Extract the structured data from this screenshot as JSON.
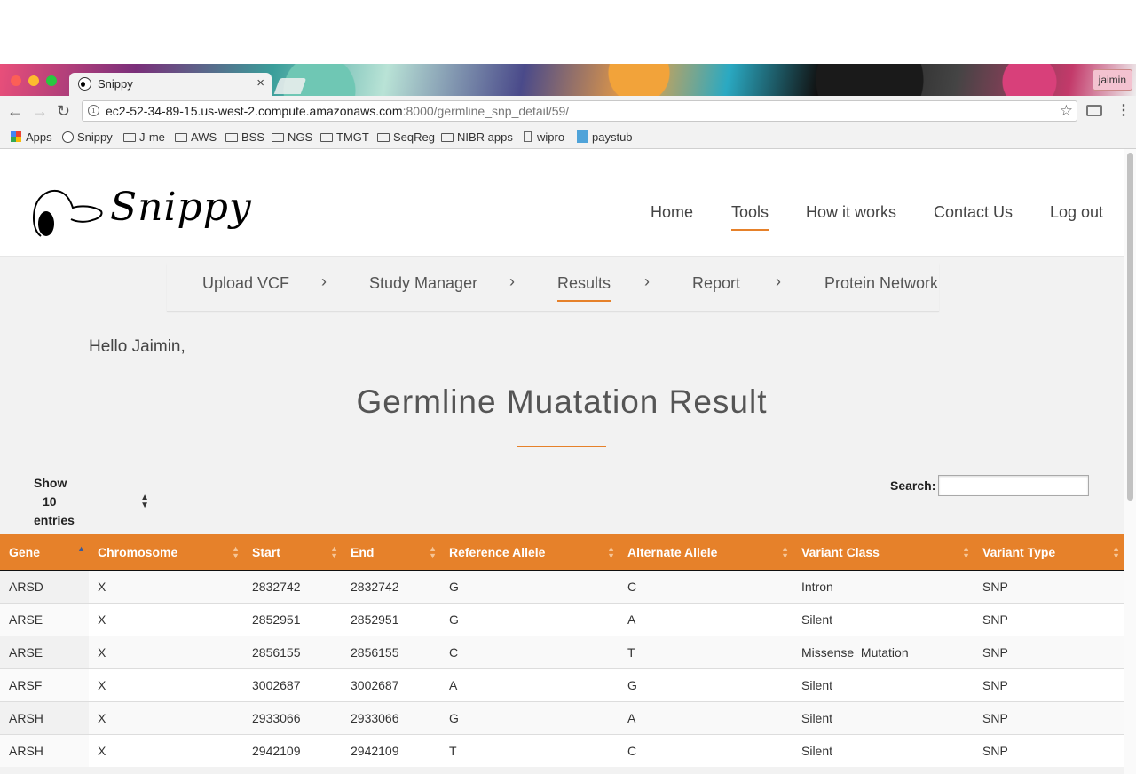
{
  "browser": {
    "tab_title": "Snippy",
    "profile": "jaimin",
    "url_host": "ec2-52-34-89-15.us-west-2.compute.amazonaws.com",
    "url_path": ":8000/germline_snp_detail/59/",
    "bookmarks": [
      "Apps",
      "Snippy",
      "J-me",
      "AWS",
      "BSS",
      "NGS",
      "TMGT",
      "SeqReg",
      "NIBR apps",
      "wipro",
      "paystub"
    ]
  },
  "site": {
    "logo_text": "Snippy",
    "nav": [
      "Home",
      "Tools",
      "How it works",
      "Contact Us",
      "Log out"
    ],
    "active_nav": "Tools"
  },
  "steps": [
    "Upload VCF",
    "Study Manager",
    "Results",
    "Report",
    "Protein Network"
  ],
  "active_step": "Results",
  "greeting": "Hello Jaimin,",
  "page_title": "Germline Muatation Result",
  "table_controls": {
    "show_label": "Show",
    "length_value": "10",
    "entries_label": "entries",
    "search_label": "Search:",
    "search_value": ""
  },
  "table": {
    "columns": [
      "Gene",
      "Chromosome",
      "Start",
      "End",
      "Reference Allele",
      "Alternate Allele",
      "Variant Class",
      "Variant Type"
    ],
    "sorted_column": "Gene",
    "rows": [
      [
        "ARSD",
        "X",
        "2832742",
        "2832742",
        "G",
        "C",
        "Intron",
        "SNP"
      ],
      [
        "ARSE",
        "X",
        "2852951",
        "2852951",
        "G",
        "A",
        "Silent",
        "SNP"
      ],
      [
        "ARSE",
        "X",
        "2856155",
        "2856155",
        "C",
        "T",
        "Missense_Mutation",
        "SNP"
      ],
      [
        "ARSF",
        "X",
        "3002687",
        "3002687",
        "A",
        "G",
        "Silent",
        "SNP"
      ],
      [
        "ARSH",
        "X",
        "2933066",
        "2933066",
        "G",
        "A",
        "Silent",
        "SNP"
      ],
      [
        "ARSH",
        "X",
        "2942109",
        "2942109",
        "T",
        "C",
        "Silent",
        "SNP"
      ]
    ]
  },
  "colors": {
    "accent": "#e6812a",
    "page_bg": "#f2f2f2"
  }
}
